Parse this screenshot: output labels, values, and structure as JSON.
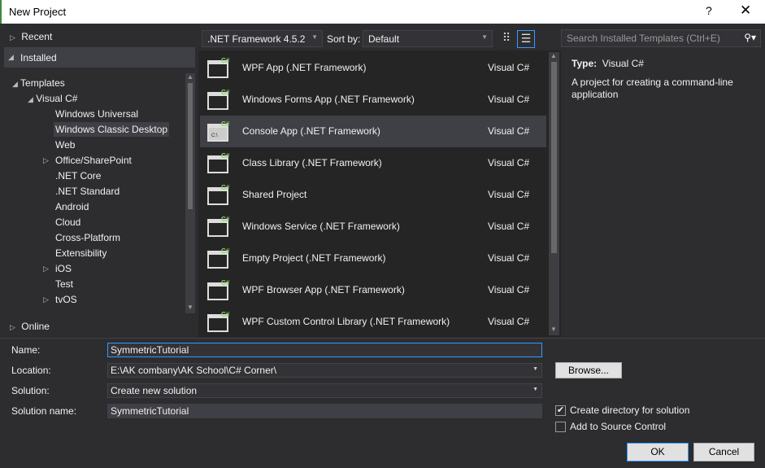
{
  "window": {
    "title": "New Project",
    "help": "?",
    "close": "✕"
  },
  "left": {
    "recent": "Recent",
    "installed": "Installed",
    "templates": "Templates",
    "visual_csharp": "Visual C#",
    "items": [
      {
        "label": "Windows Universal",
        "expand": false
      },
      {
        "label": "Windows Classic Desktop",
        "expand": false,
        "selected": true
      },
      {
        "label": "Web",
        "expand": false
      },
      {
        "label": "Office/SharePoint",
        "expand": true
      },
      {
        "label": ".NET Core",
        "expand": false
      },
      {
        "label": ".NET Standard",
        "expand": false
      },
      {
        "label": "Android",
        "expand": false
      },
      {
        "label": "Cloud",
        "expand": false
      },
      {
        "label": "Cross-Platform",
        "expand": false
      },
      {
        "label": "Extensibility",
        "expand": false
      },
      {
        "label": "iOS",
        "expand": true
      },
      {
        "label": "Test",
        "expand": false
      },
      {
        "label": "tvOS",
        "expand": true
      }
    ],
    "online": "Online"
  },
  "toolbar": {
    "framework": ".NET Framework 4.5.2",
    "sort_label": "Sort by:",
    "sort_value": "Default",
    "search_placeholder": "Search Installed Templates (Ctrl+E)"
  },
  "templates": [
    {
      "name": "WPF App (.NET Framework)",
      "lang": "Visual C#",
      "icon": "wpf-app-icon"
    },
    {
      "name": "Windows Forms App (.NET Framework)",
      "lang": "Visual C#",
      "icon": "windows-forms-icon"
    },
    {
      "name": "Console App (.NET Framework)",
      "lang": "Visual C#",
      "icon": "console-app-icon",
      "selected": true
    },
    {
      "name": "Class Library (.NET Framework)",
      "lang": "Visual C#",
      "icon": "class-library-icon"
    },
    {
      "name": "Shared Project",
      "lang": "Visual C#",
      "icon": "shared-project-icon"
    },
    {
      "name": "Windows Service (.NET Framework)",
      "lang": "Visual C#",
      "icon": "windows-service-icon"
    },
    {
      "name": "Empty Project (.NET Framework)",
      "lang": "Visual C#",
      "icon": "empty-project-icon"
    },
    {
      "name": "WPF Browser App (.NET Framework)",
      "lang": "Visual C#",
      "icon": "wpf-browser-icon"
    },
    {
      "name": "WPF Custom Control Library (.NET Framework)",
      "lang": "Visual C#",
      "icon": "wpf-custom-control-icon"
    }
  ],
  "details": {
    "type_label": "Type:",
    "type_value": "Visual C#",
    "description": "A project for creating a command-line application"
  },
  "form": {
    "name_label": "Name:",
    "name_value": "SymmetricTutorial",
    "location_label": "Location:",
    "location_value": "E:\\AK combany\\AK School\\C# Corner\\",
    "solution_label": "Solution:",
    "solution_value": "Create new solution",
    "solution_name_label": "Solution name:",
    "solution_name_value": "SymmetricTutorial",
    "browse": "Browse...",
    "create_dir": "Create directory for solution",
    "create_dir_checked": true,
    "source_control": "Add to Source Control",
    "source_control_checked": false,
    "ok": "OK",
    "cancel": "Cancel"
  },
  "colors": {
    "accent": "#3399ff",
    "csharp": "#8ad46a"
  }
}
